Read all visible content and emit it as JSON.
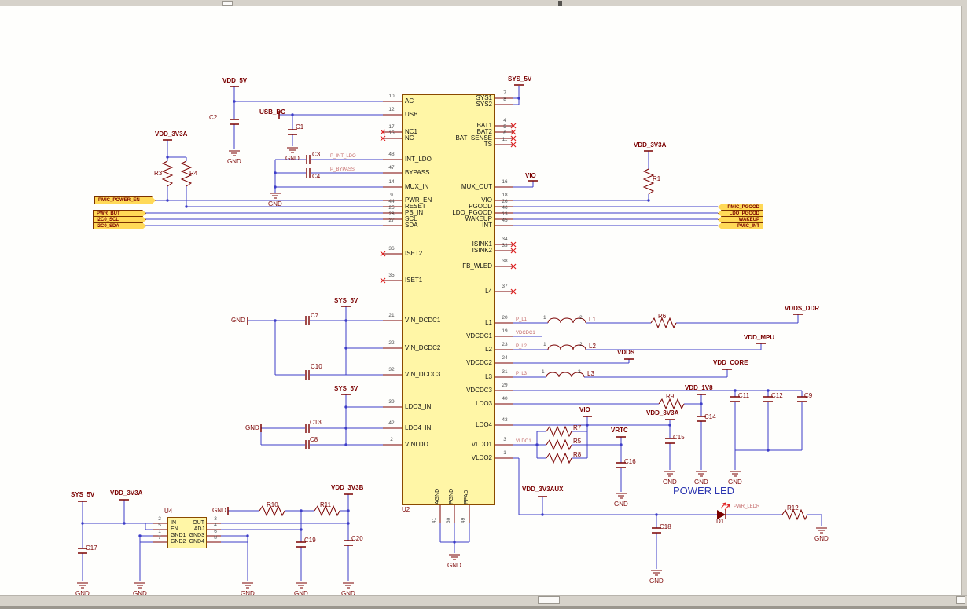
{
  "ic_u2": {
    "ref": "U2",
    "left_pins": [
      {
        "num": "10",
        "name": "AC"
      },
      {
        "num": "12",
        "name": "USB"
      },
      {
        "num": "17",
        "name": "NC1"
      },
      {
        "num": "15",
        "name": "NC"
      },
      {
        "num": "48",
        "name": "INT_LDO"
      },
      {
        "num": "47",
        "name": "BYPASS"
      },
      {
        "num": "14",
        "name": "MUX_IN"
      },
      {
        "num": "9",
        "name": "PWR_EN"
      },
      {
        "num": "44",
        "name": "RESET"
      },
      {
        "num": "25",
        "name": "PB_IN"
      },
      {
        "num": "28",
        "name": "SCL"
      },
      {
        "num": "27",
        "name": "SDA"
      },
      {
        "num": "36",
        "name": "ISET2"
      },
      {
        "num": "35",
        "name": "ISET1"
      },
      {
        "num": "21",
        "name": "VIN_DCDC1"
      },
      {
        "num": "22",
        "name": "VIN_DCDC2"
      },
      {
        "num": "32",
        "name": "VIN_DCDC3"
      },
      {
        "num": "39",
        "name": "LDO3_IN"
      },
      {
        "num": "42",
        "name": "LDO4_IN"
      },
      {
        "num": "2",
        "name": "VINLDO"
      }
    ],
    "right_pins": [
      {
        "num": "7",
        "name": "SYS1"
      },
      {
        "num": "8",
        "name": "SYS2"
      },
      {
        "num": "4",
        "name": "BAT1"
      },
      {
        "num": "5",
        "name": "BAT2"
      },
      {
        "num": "6",
        "name": "BAT_SENSE"
      },
      {
        "num": "11",
        "name": "TS"
      },
      {
        "num": "16",
        "name": "MUX_OUT"
      },
      {
        "num": "18",
        "name": "VIO"
      },
      {
        "num": "26",
        "name": "PGOOD"
      },
      {
        "num": "46",
        "name": "LDO_PGOOD"
      },
      {
        "num": "13",
        "name": "WAKEUP"
      },
      {
        "num": "45",
        "name": "INT"
      },
      {
        "num": "34",
        "name": "ISINK1"
      },
      {
        "num": "33",
        "name": "ISINK2"
      },
      {
        "num": "38",
        "name": "FB_WLED"
      },
      {
        "num": "37",
        "name": "L4"
      },
      {
        "num": "20",
        "name": "L1"
      },
      {
        "num": "19",
        "name": "VDCDC1"
      },
      {
        "num": "23",
        "name": "L2"
      },
      {
        "num": "24",
        "name": "VDCDC2"
      },
      {
        "num": "31",
        "name": "L3"
      },
      {
        "num": "29",
        "name": "VDCDC3"
      },
      {
        "num": "40",
        "name": "LDO3"
      },
      {
        "num": "43",
        "name": "LDO4"
      },
      {
        "num": "3",
        "name": "VLDO1"
      },
      {
        "num": "1",
        "name": "VLDO2"
      }
    ],
    "bottom_pins": [
      {
        "num": "41",
        "name": "AGND"
      },
      {
        "num": "30",
        "name": "PGND"
      },
      {
        "num": "49",
        "name": "PPAD"
      }
    ]
  },
  "u4": {
    "ref": "U4",
    "left_pins": [
      {
        "num": "2",
        "name": "IN"
      },
      {
        "num": "5",
        "name": "EN"
      },
      {
        "num": "1",
        "name": "GND1"
      },
      {
        "num": "7",
        "name": "GND2"
      }
    ],
    "right_pins": [
      {
        "num": "3",
        "name": "OUT"
      },
      {
        "num": "4",
        "name": "ADJ"
      },
      {
        "num": "6",
        "name": "GND3"
      },
      {
        "num": "8",
        "name": "GND4"
      }
    ]
  },
  "ports": {
    "left": [
      "PMIC_POWER_EN",
      "PWR_BUT",
      "I2C0_SCL",
      "I2C0_SDA"
    ],
    "right": [
      "PMIC_PGOOD",
      "LDO_PGOOD",
      "WAKEUP",
      "PMIC_INT"
    ]
  },
  "power_nets": {
    "vdd_5v": "VDD_5V",
    "sys_5v": "SYS_5V",
    "vdd_3v3a": "VDD_3V3A",
    "usb_dc": "USB_DC",
    "vio": "VIO",
    "vdds_ddr": "VDDS_DDR",
    "vdd_mpu": "VDD_MPU",
    "vdds": "VDDS",
    "vdd_core": "VDD_CORE",
    "vdd_1v8": "VDD_1V8",
    "vrtc": "VRTC",
    "vdd_3v3aux": "VDD_3V3AUX",
    "vdd_3v3b": "VDD_3V3B",
    "gnd": "GND"
  },
  "refdes": {
    "c1": "C1",
    "c2": "C2",
    "c3": "C3",
    "c4": "C4",
    "c7": "C7",
    "c8": "C8",
    "c9": "C9",
    "c10": "C10",
    "c11": "C11",
    "c12": "C12",
    "c13": "C13",
    "c14": "C14",
    "c15": "C15",
    "c16": "C16",
    "c17": "C17",
    "c18": "C18",
    "c19": "C19",
    "c20": "C20",
    "r1": "R1",
    "r3": "R3",
    "r4": "R4",
    "r5": "R5",
    "r6": "R6",
    "r7": "R7",
    "r8": "R8",
    "r9": "R9",
    "r10": "R10",
    "r11": "R11",
    "r12": "R12",
    "l1": "L1",
    "l2": "L2",
    "l3": "L3",
    "d1": "D1"
  },
  "sub_labels": {
    "p_int_ldo": "P_INT_LDO",
    "p_bypass": "P_BYPASS",
    "p_l1": "P_L1",
    "p_l2": "P_L2",
    "p_l3": "P_L3",
    "vdcdc1": "VDCDC1",
    "vldo1": "VLDO1",
    "pwr_ledr": "PWR_LEDR"
  },
  "annotations": {
    "power_led": "POWER LED"
  },
  "marks": {
    "one": "1",
    "two": "2"
  }
}
